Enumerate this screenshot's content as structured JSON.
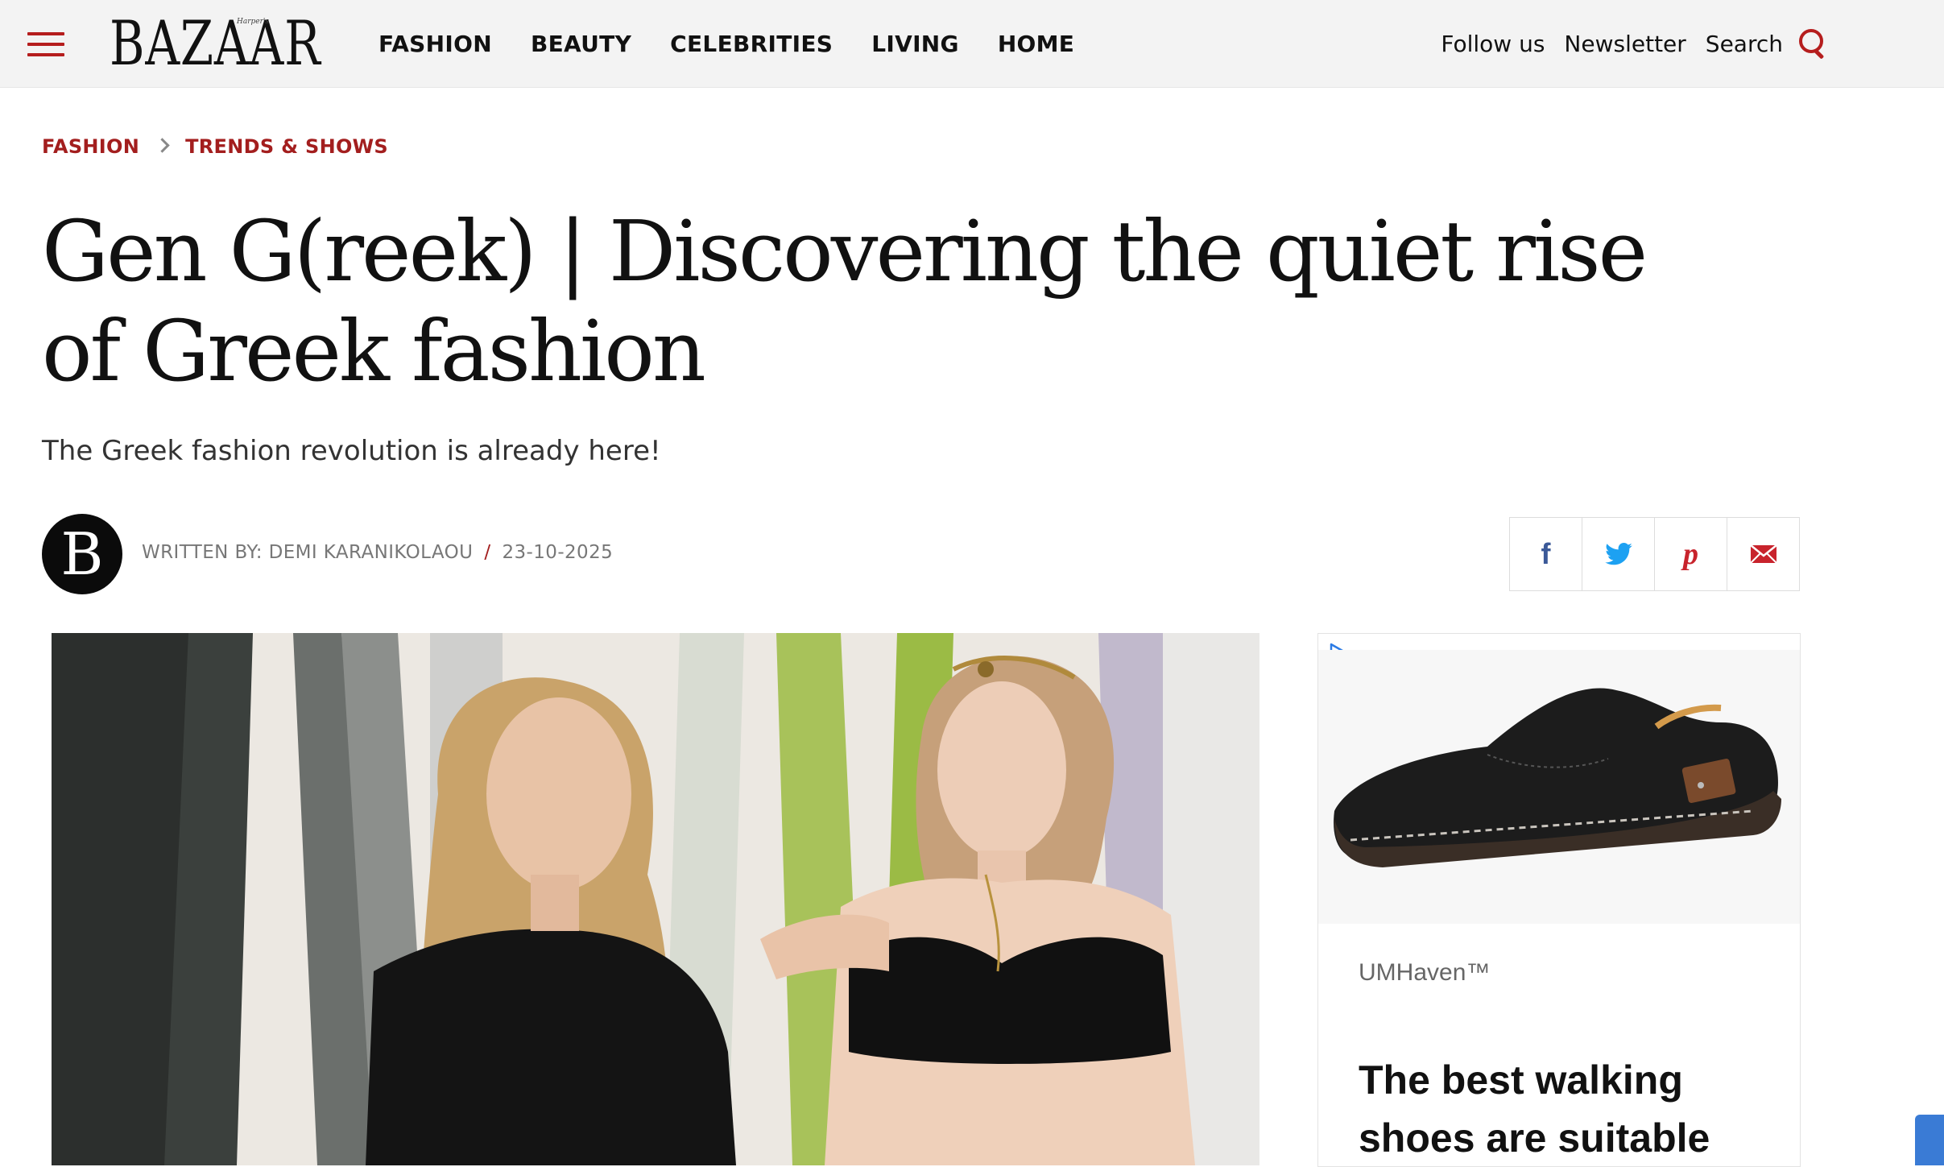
{
  "header": {
    "logo_text": "BAZAAR",
    "logo_small": "Harper's",
    "nav": [
      "FASHION",
      "BEAUTY",
      "CELEBRITIES",
      "LIVING",
      "HOME"
    ],
    "follow_label": "Follow us",
    "newsletter_label": "Newsletter",
    "search_label": "Search"
  },
  "breadcrumb": {
    "section": "FASHION",
    "subsection": "TRENDS & SHOWS"
  },
  "article": {
    "title": "Gen G(reek) | Discovering the quiet rise of Greek fashion",
    "subtitle": "The Greek fashion revolution is already here!",
    "author_initial": "B",
    "byline": "WRITTEN BY: DEMI KARANIKOLAOU",
    "date": "23-10-2025"
  },
  "share": {
    "icons": [
      "facebook-icon",
      "twitter-icon",
      "pinterest-icon",
      "email-icon"
    ],
    "colors": {
      "facebook": "#3b5998",
      "twitter": "#1da1f2",
      "pinterest": "#c8232c",
      "email": "#c8232c"
    }
  },
  "ad": {
    "brand": "UMHaven™",
    "headline": "The best walking shoes are suitable"
  },
  "colors": {
    "accent": "#a31e1e",
    "header_bg": "#f3f3f3"
  }
}
